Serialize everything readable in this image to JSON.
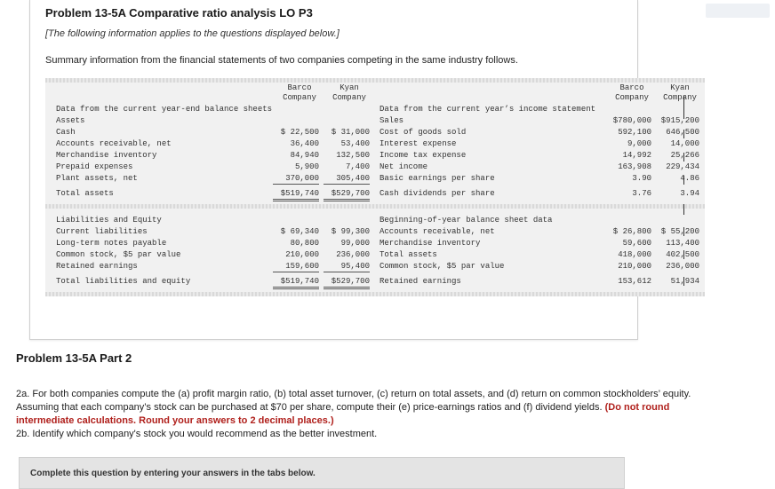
{
  "header": {
    "title": "Problem 13-5A Comparative ratio analysis LO P3",
    "note": "[The following information applies to the questions displayed below.]",
    "intro": "Summary information from the financial statements of two companies competing in the same industry follows."
  },
  "columns": {
    "barco_1": "Barco",
    "barco_2": "Company",
    "kyan_1": "Kyan",
    "kyan_2": "Company"
  },
  "balance": {
    "heading": "Data from the current year-end balance sheets",
    "assets_label": "Assets",
    "assets": [
      {
        "label": "Cash",
        "barco": "$ 22,500",
        "kyan": "$ 31,000"
      },
      {
        "label": "Accounts receivable, net",
        "barco": "36,400",
        "kyan": "53,400"
      },
      {
        "label": "Merchandise inventory",
        "barco": "84,940",
        "kyan": "132,500"
      },
      {
        "label": "Prepaid expenses",
        "barco": "5,900",
        "kyan": "7,400"
      },
      {
        "label": "Plant assets, net",
        "barco": "370,000",
        "kyan": "305,400"
      }
    ],
    "total_assets": {
      "label": "Total assets",
      "barco": "$519,740",
      "kyan": "$529,700"
    },
    "liab_label": "Liabilities and Equity",
    "liabilities": [
      {
        "label": "Current liabilities",
        "barco": "$ 69,340",
        "kyan": "$ 99,300"
      },
      {
        "label": "Long-term notes payable",
        "barco": "80,800",
        "kyan": "99,000"
      },
      {
        "label": "Common stock, $5 par value",
        "barco": "210,000",
        "kyan": "236,000"
      },
      {
        "label": "Retained earnings",
        "barco": "159,600",
        "kyan": "95,400"
      }
    ],
    "total_liab": {
      "label": "Total liabilities and equity",
      "barco": "$519,740",
      "kyan": "$529,700"
    }
  },
  "income": {
    "heading": "Data from the current year’s income statement",
    "rows": [
      {
        "label": "Sales",
        "barco": "$780,000",
        "kyan": "$915,200"
      },
      {
        "label": "Cost of goods sold",
        "barco": "592,100",
        "kyan": "646,500"
      },
      {
        "label": "Interest expense",
        "barco": "9,000",
        "kyan": "14,000"
      },
      {
        "label": "Income tax expense",
        "barco": "14,992",
        "kyan": "25,266"
      },
      {
        "label": "Net income",
        "barco": "163,908",
        "kyan": "229,434"
      },
      {
        "label": "Basic earnings per share",
        "barco": "3.90",
        "kyan": "4.86"
      }
    ],
    "dividends": {
      "label": "Cash dividends per share",
      "barco": "3.76",
      "kyan": "3.94"
    }
  },
  "beginning": {
    "heading": "Beginning-of-year balance sheet data",
    "rows": [
      {
        "label": "Accounts receivable, net",
        "barco": "$ 26,800",
        "kyan": "$ 55,200"
      },
      {
        "label": "Merchandise inventory",
        "barco": "59,600",
        "kyan": "113,400"
      },
      {
        "label": "Total assets",
        "barco": "418,000",
        "kyan": "402,500"
      },
      {
        "label": "Common stock, $5 par value",
        "barco": "210,000",
        "kyan": "236,000"
      },
      {
        "label": "Retained earnings",
        "barco": "153,612",
        "kyan": "51,934"
      }
    ]
  },
  "part": {
    "title": "Problem 13-5A Part 2",
    "task_a": "2a. For both companies compute the (a) profit margin ratio, (b) total asset turnover, (c) return on total assets, and (d) return on common stockholders’ equity. Assuming that each company’s stock can be purchased at $70 per share, compute their (e) price-earnings ratios and (f) dividend yields.",
    "task_bold": "(Do not round intermediate calculations. Round your answers to 2 decimal places.)",
    "task_b": "2b. Identify which company's stock you would recommend as the better investment."
  },
  "complete_text": "Complete this question by entering your answers in the tabs below."
}
